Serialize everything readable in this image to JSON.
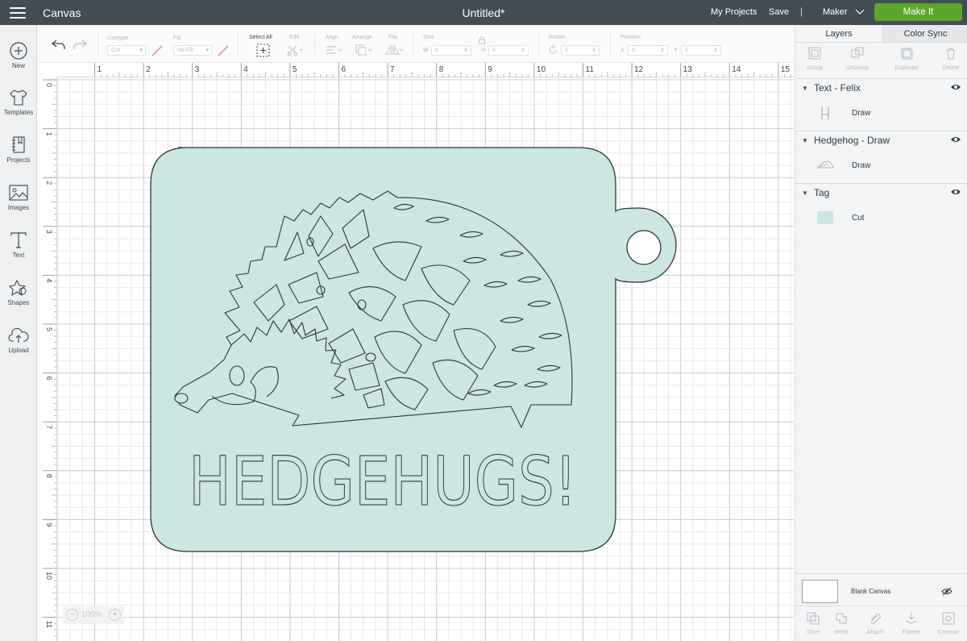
{
  "topbar": {
    "app_title": "Canvas",
    "doc_title": "Untitled*",
    "my_projects": "My Projects",
    "save": "Save",
    "separator": "|",
    "machine": "Maker",
    "make_it": "Make It",
    "bar_color": "#414c55",
    "make_it_color": "#5ba52b"
  },
  "left_nav": {
    "items": [
      {
        "label": "New",
        "icon": "plus-circle-icon"
      },
      {
        "label": "Templates",
        "icon": "tshirt-icon"
      },
      {
        "label": "Projects",
        "icon": "projects-icon"
      },
      {
        "label": "Images",
        "icon": "image-icon"
      },
      {
        "label": "Text",
        "icon": "text-icon"
      },
      {
        "label": "Shapes",
        "icon": "shapes-icon"
      },
      {
        "label": "Upload",
        "icon": "upload-cloud-icon"
      }
    ]
  },
  "toolbar": {
    "linetype_label": "Linetype",
    "linetype_value": "Cut",
    "fill_label": "Fill",
    "fill_value": "No Fill",
    "select_all_label": "Select All",
    "edit_label": "Edit",
    "align_label": "Align",
    "arrange_label": "Arrange",
    "flip_label": "Flip",
    "size_label": "Size",
    "w_label": "W",
    "w_value": "0",
    "h_label": "H",
    "h_value": "0",
    "rotate_label": "Rotate",
    "rotate_value": "0",
    "position_label": "Position",
    "x_label": "X",
    "x_value": "0",
    "y_label": "Y",
    "y_value": "0"
  },
  "canvas": {
    "ruler_top": [
      "1",
      "2",
      "3",
      "4",
      "5",
      "6",
      "7",
      "8",
      "9",
      "10",
      "11",
      "12",
      "13",
      "14",
      "15"
    ],
    "ruler_left": [
      "0",
      "1",
      "2",
      "3",
      "4",
      "5",
      "6",
      "7",
      "8",
      "9",
      "10",
      "11"
    ],
    "design_text": "HEDGEHUGS!",
    "tag_color": "#cce6e2",
    "stroke_color": "#2d3438",
    "zoom_minus": "−",
    "zoom_value": "100%",
    "zoom_plus": "+"
  },
  "right_panel": {
    "tabs": [
      "Layers",
      "Color Sync"
    ],
    "actions": [
      "Group",
      "UnGroup",
      "Duplicate",
      "Delete"
    ],
    "layers": [
      {
        "title": "Text - Felix",
        "op": "Draw"
      },
      {
        "title": "Hedgehog - Draw",
        "op": "Draw"
      },
      {
        "title": "Tag",
        "op": "Cut"
      }
    ],
    "blank_canvas": "Blank Canvas",
    "bottom_actions": [
      "Slice",
      "Weld",
      "Attach",
      "Flatten",
      "Contour"
    ]
  }
}
